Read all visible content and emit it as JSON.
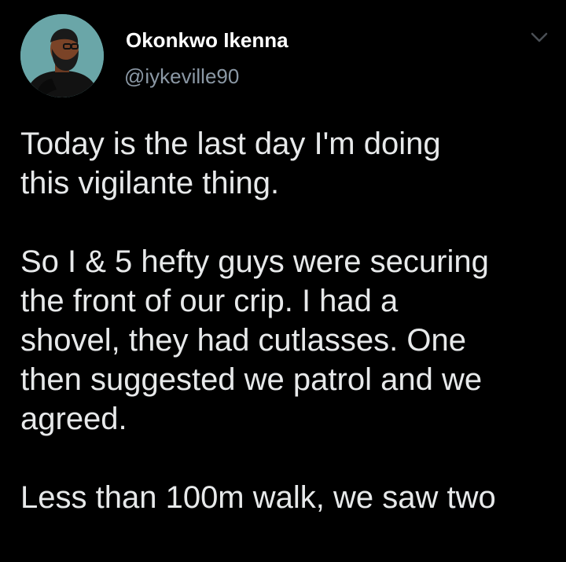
{
  "tweet": {
    "author": {
      "display_name": "Okonkwo Ikenna",
      "handle": "@iykeville90",
      "avatar_icon": "avatar-illustration"
    },
    "menu_icon": "chevron-down-icon",
    "paragraphs": [
      "Today is the last day I'm doing\nthis vigilante thing.",
      "So I & 5 hefty guys were securing\nthe front of our crip. I had a\nshovel, they had cutlasses. One\nthen suggested we patrol and we\nagreed.",
      "Less than 100m walk, we saw two"
    ]
  },
  "colors": {
    "background": "#000000",
    "name": "#ffffff",
    "handle": "#8b98a5",
    "text": "#e7e9ea",
    "avatar_bg": "#5a9a9a"
  }
}
